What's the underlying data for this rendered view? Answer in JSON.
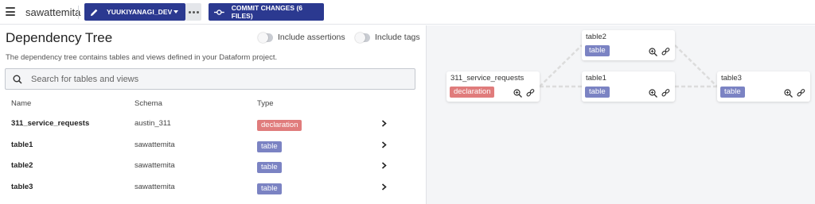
{
  "topbar": {
    "project_name": "sawattemita",
    "branch_label": "YUUKIYANAGI_DEV",
    "commit_label": "COMMIT CHANGES (6 FILES)"
  },
  "panel": {
    "title": "Dependency Tree",
    "toggle_assertions_label": "Include assertions",
    "toggle_tags_label": "Include tags",
    "description": "The dependency tree contains tables and views defined in your Dataform project.",
    "search_placeholder": "Search for tables and views",
    "columns": {
      "name": "Name",
      "schema": "Schema",
      "type": "Type"
    },
    "rows": [
      {
        "name": "311_service_requests",
        "schema": "austin_311",
        "type": "declaration"
      },
      {
        "name": "table1",
        "schema": "sawattemita",
        "type": "table"
      },
      {
        "name": "table2",
        "schema": "sawattemita",
        "type": "table"
      },
      {
        "name": "table3",
        "schema": "sawattemita",
        "type": "table"
      }
    ]
  },
  "graph": {
    "nodes": [
      {
        "name": "311_service_requests",
        "type": "declaration"
      },
      {
        "name": "table2",
        "type": "table"
      },
      {
        "name": "table1",
        "type": "table"
      },
      {
        "name": "table3",
        "type": "table"
      }
    ]
  },
  "colors": {
    "primary": "#2b3990",
    "declaration_badge": "#e07c7c",
    "table_badge": "#7b83c3"
  }
}
